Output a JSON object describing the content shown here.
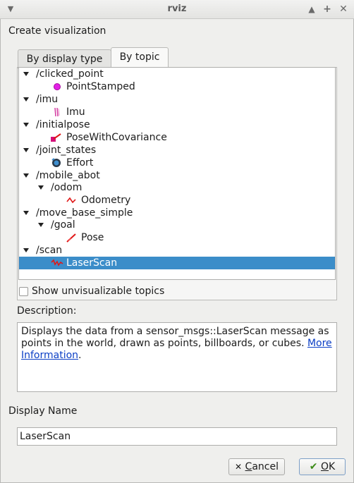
{
  "window": {
    "title": "rviz",
    "titlebar_buttons": [
      "up-arrow-icon",
      "maximize-icon",
      "close-icon"
    ]
  },
  "heading": "Create visualization",
  "tabs": [
    {
      "label": "By display type",
      "active": false
    },
    {
      "label": "By topic",
      "active": true
    }
  ],
  "tree": {
    "rows": [
      {
        "label": "/clicked_point",
        "type": "topic",
        "expanded": true
      },
      {
        "label": "PointStamped",
        "type": "display",
        "icon": "point-stamped-icon"
      },
      {
        "label": "/imu",
        "type": "topic",
        "expanded": true
      },
      {
        "label": "Imu",
        "type": "display",
        "icon": "imu-icon"
      },
      {
        "label": "/initialpose",
        "type": "topic",
        "expanded": true
      },
      {
        "label": "PoseWithCovariance",
        "type": "display",
        "icon": "pose-with-covariance-icon"
      },
      {
        "label": "/joint_states",
        "type": "topic",
        "expanded": true
      },
      {
        "label": "Effort",
        "type": "display",
        "icon": "effort-icon"
      },
      {
        "label": "/mobile_abot",
        "type": "topic",
        "expanded": true
      },
      {
        "label": "/odom",
        "type": "subtopic",
        "expanded": true
      },
      {
        "label": "Odometry",
        "type": "display",
        "icon": "odometry-icon"
      },
      {
        "label": "/move_base_simple",
        "type": "topic",
        "expanded": true
      },
      {
        "label": "/goal",
        "type": "subtopic",
        "expanded": true
      },
      {
        "label": "Pose",
        "type": "display",
        "icon": "pose-icon"
      },
      {
        "label": "/scan",
        "type": "topic",
        "expanded": true
      },
      {
        "label": "LaserScan",
        "type": "display",
        "icon": "laser-scan-icon",
        "selected": true
      }
    ]
  },
  "show_unvisualizable": {
    "label": "Show unvisualizable topics",
    "checked": false
  },
  "description": {
    "label": "Description:",
    "text": "Displays the data from a sensor_msgs::LaserScan message as points in the world, drawn as points, billboards, or cubes.",
    "link_text_line1": "More",
    "link_text_line2": "Information",
    "trailing": "."
  },
  "display_name": {
    "label": "Display Name",
    "value": "LaserScan"
  },
  "buttons": {
    "cancel": {
      "label_prefix": "",
      "mnemonic": "C",
      "label_rest": "ancel",
      "icon": "x-icon"
    },
    "ok": {
      "mnemonic": "O",
      "label_rest": "K",
      "icon": "checkmark-icon"
    }
  },
  "colors": {
    "selection": "#3b8dc9",
    "link": "#0a3ec5",
    "window_bg": "#efefed"
  }
}
